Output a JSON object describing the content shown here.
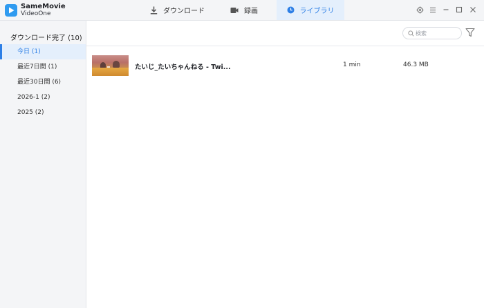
{
  "app": {
    "name_line1": "SameMovie",
    "name_line2": "VideoOne"
  },
  "nav": {
    "tabs": [
      {
        "label": "ダウンロード",
        "icon": "download-icon"
      },
      {
        "label": "録画",
        "icon": "video-camera-icon"
      },
      {
        "label": "ライブラリ",
        "icon": "clock-icon",
        "active": true
      }
    ]
  },
  "sidebar": {
    "title": "ダウンロード完了 (10)",
    "items": [
      {
        "label": "今日 (1)",
        "active": true
      },
      {
        "label": "最近7日間 (1)"
      },
      {
        "label": "最近30日間 (6)"
      },
      {
        "label": "2026-1 (2)"
      },
      {
        "label": "2025 (2)"
      }
    ]
  },
  "toolbar": {
    "search_placeholder": "検索",
    "search_value": ""
  },
  "library": {
    "items": [
      {
        "title": "たいじ_たいちゃんねる - Twi...",
        "duration": "1 min",
        "size": "46.3 MB"
      }
    ]
  },
  "colors": {
    "accent": "#2d7fe6",
    "sidebar_bg": "#f4f5f7",
    "active_bg": "#e4effc"
  }
}
